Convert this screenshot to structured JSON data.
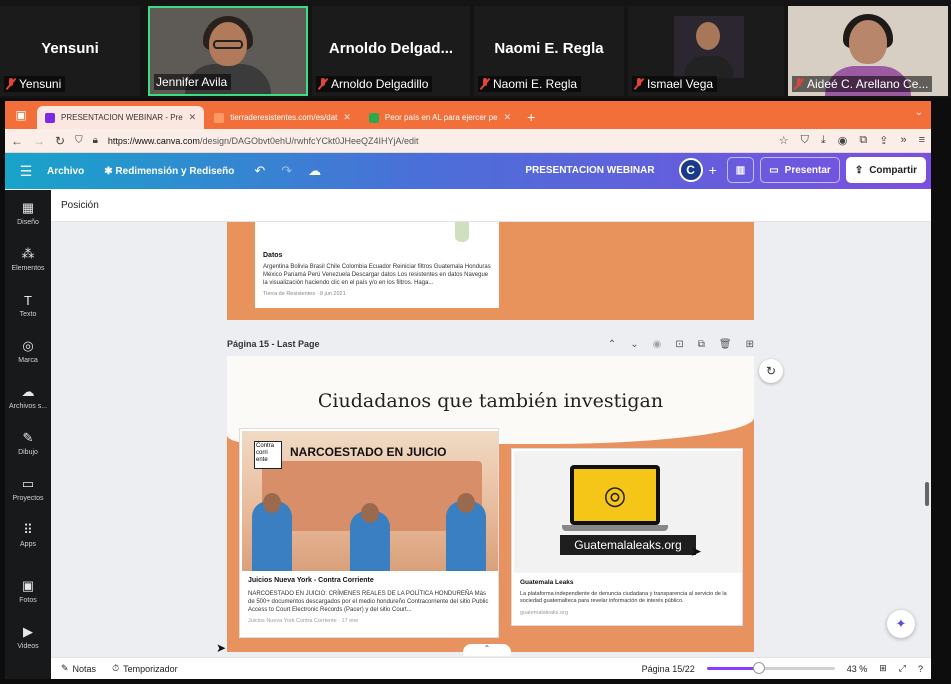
{
  "meeting": {
    "participants": [
      {
        "big_name": "Yensuni",
        "tag": "Yensuni",
        "muted": true
      },
      {
        "big_name": "",
        "tag": "Jennifer Avila",
        "muted": false,
        "active": true
      },
      {
        "big_name": "Arnoldo Delgad...",
        "tag": "Arnoldo Delgadillo",
        "muted": true
      },
      {
        "big_name": "Naomi E. Regla",
        "tag": "Naomi E. Regla",
        "muted": true
      },
      {
        "big_name": "",
        "tag": "Ismael Vega",
        "muted": true
      },
      {
        "big_name": "",
        "tag": "Aideé C. Arellano Ce...",
        "muted": true
      }
    ]
  },
  "browser": {
    "tabs": [
      {
        "label": "PRESENTACION WEBINAR - Pre",
        "active": true,
        "fav_color": "#7d2ae8"
      },
      {
        "label": "tierraderesistentes.com/es/dat",
        "active": false,
        "fav_color": "#ff9966"
      },
      {
        "label": "Peor país en AL para ejercer pe",
        "active": false,
        "fav_color": "#2ca84f"
      }
    ],
    "url_host": "https://www.canva.com",
    "url_path": "/design/DAGObvt0ehU/rwhfcYCkt0JHeeQZ4IHYjA/edit"
  },
  "canva": {
    "menu_archivo": "Archivo",
    "menu_resize": "Redimensión y Rediseño",
    "doc_title": "PRESENTACION WEBINAR",
    "avatar_letter": "C",
    "present_label": "Presentar",
    "share_label": "Compartir",
    "topbar_label": "Posición",
    "sidebar": [
      {
        "label": "Diseño",
        "icon": "▦",
        "name": "design"
      },
      {
        "label": "Elementos",
        "icon": "⁂",
        "name": "elements"
      },
      {
        "label": "Texto",
        "icon": "T",
        "name": "text"
      },
      {
        "label": "Marca",
        "icon": "◎",
        "name": "brand"
      },
      {
        "label": "Archivos s...",
        "icon": "☁",
        "name": "uploads"
      },
      {
        "label": "Dibujo",
        "icon": "✎",
        "name": "draw"
      },
      {
        "label": "Proyectos",
        "icon": "▭",
        "name": "projects"
      },
      {
        "label": "Apps",
        "icon": "⠿",
        "name": "apps"
      },
      {
        "label": "Fotos",
        "icon": "▣",
        "name": "photos"
      },
      {
        "label": "Videos",
        "icon": "▶",
        "name": "videos"
      }
    ],
    "page14_card": {
      "title": "Datos",
      "text": "Argentina Bolivia Brasil Chile Colombia Ecuador Reiniciar filtros Guatemala Honduras México Panamá Perú Venezuela Descargar datos Los resistentes en datos Navegue la visualización haciendo clic en el país y/o en los filtros. Haga...",
      "source": "Tierra de Resistentes · 8 jun 2021"
    },
    "page15_label": "Página 15 - Last Page",
    "page15_title": "Ciudadanos que también investigan",
    "card_a": {
      "illus_logo": "Contra corri ente",
      "illus_heading": "NARCOESTADO EN JUICIO",
      "title": "Juicios Nueva York - Contra Corriente",
      "text": "NARCOESTADO EN JUICIO: CRÍMENES REALES DE LA POLÍTICA HONDUREÑA Más de 500+ documentos descargados por el medio hondureño Contracorriente del sitio Public Access to Court Electronic Records (Pacer) y del sitio Court...",
      "source": "Juicios Nueva York Contra Corriente · 17 ene"
    },
    "card_b": {
      "banner": "Guatemalaleaks.org",
      "title": "Guatemala Leaks",
      "text": "La plataforma independiente de denuncia ciudadana y transparencia al servicio de la sociedad guatemalteca para revelar información de interés público.",
      "source": "guatemalaleaks.org"
    },
    "bottom": {
      "notes": "Notas",
      "timer": "Temporizador",
      "page_indicator": "Página 15/22",
      "zoom": "43 %",
      "zoom_level": 0.43
    },
    "colors": {
      "brand_orange": "#f36f3a",
      "canva_gradient_start": "#17a4c9",
      "canva_gradient_end": "#7b4fe0",
      "slide_orange": "#e8935f"
    }
  }
}
